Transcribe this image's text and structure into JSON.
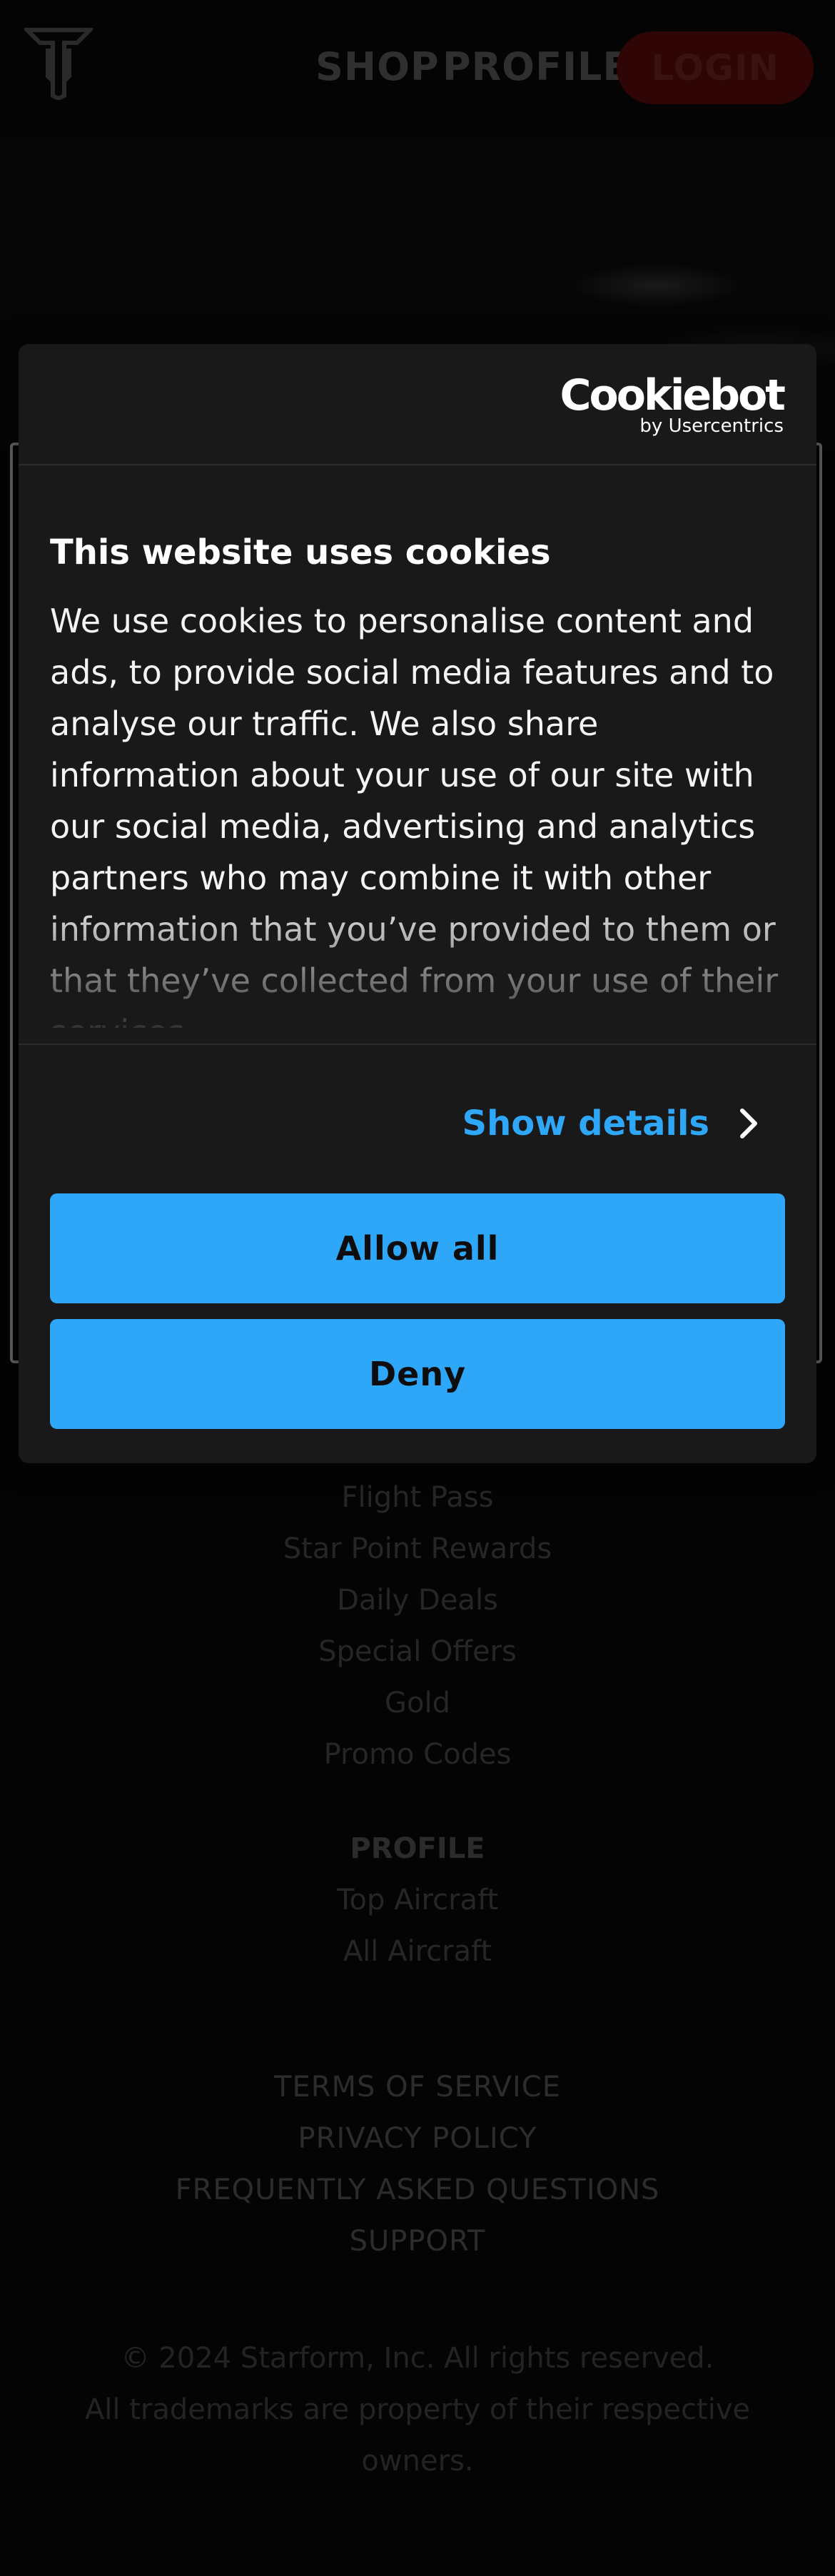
{
  "header": {
    "logo_name": "starform-logo",
    "nav": [
      {
        "label": "SHOP"
      },
      {
        "label": "PROFILE"
      }
    ],
    "login_label": "LOGIN"
  },
  "footer": {
    "shop_links": [
      "Flight Pass",
      "Star Point Rewards",
      "Daily Deals",
      "Special Offers",
      "Gold",
      "Promo Codes"
    ],
    "profile_heading": "PROFILE",
    "profile_links": [
      "Top Aircraft",
      "All Aircraft"
    ],
    "legal_links": [
      "TERMS OF SERVICE",
      "PRIVACY POLICY",
      "FREQUENTLY ASKED QUESTIONS",
      "SUPPORT"
    ],
    "copyright_line1": "© 2024 Starform, Inc. All rights reserved.",
    "copyright_line2": "All trademarks are property of their respective",
    "copyright_line3": "owners."
  },
  "cookie_dialog": {
    "brand": "Cookiebot",
    "brand_sub": "by Usercentrics",
    "title": "This website uses cookies",
    "text": "We use cookies to personalise content and ads, to provide social media features and to analyse our traffic. We also share information about your use of our site with our social media, advertising and analytics partners who may combine it with other information that you’ve provided to them or that they’ve collected from your use of their services.",
    "show_details_label": "Show details",
    "allow_all_label": "Allow all",
    "deny_label": "Deny"
  },
  "colors": {
    "accent": "#2ea7f8",
    "dialog_bg": "#191919",
    "page_bg": "#040404",
    "login_bg": "#300505"
  }
}
